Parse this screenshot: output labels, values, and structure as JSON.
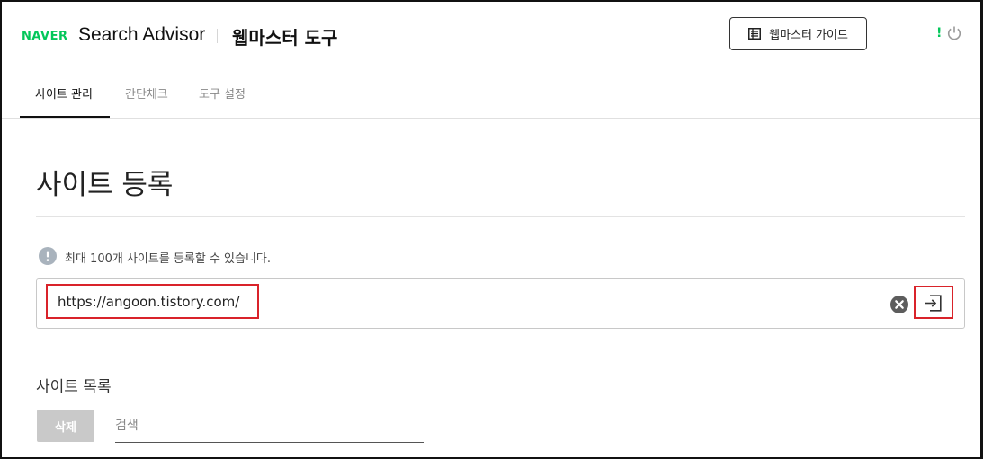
{
  "header": {
    "logo": "NAVER",
    "product": "Search Advisor",
    "tool_name": "웹마스터 도구",
    "guide_button": "웹마스터 가이드",
    "notice_mark": "!"
  },
  "tabs": [
    {
      "label": "사이트 관리",
      "active": true
    },
    {
      "label": "간단체크",
      "active": false
    },
    {
      "label": "도구 설정",
      "active": false
    }
  ],
  "main": {
    "title": "사이트 등록",
    "info_text": "최대 100개 사이트를 등록할 수 있습니다.",
    "url_input": {
      "value": "https://angoon.tistory.com/"
    }
  },
  "site_list": {
    "title": "사이트 목록",
    "delete_button": "삭제",
    "search_placeholder": "검색"
  },
  "colors": {
    "brand": "#03c75a",
    "highlight": "#d9232a",
    "disabled_button": "#c9c9c9"
  },
  "icons": {
    "guide": "book-icon",
    "power": "power-icon",
    "info": "info-icon",
    "clear": "clear-icon",
    "submit": "enter-icon"
  }
}
